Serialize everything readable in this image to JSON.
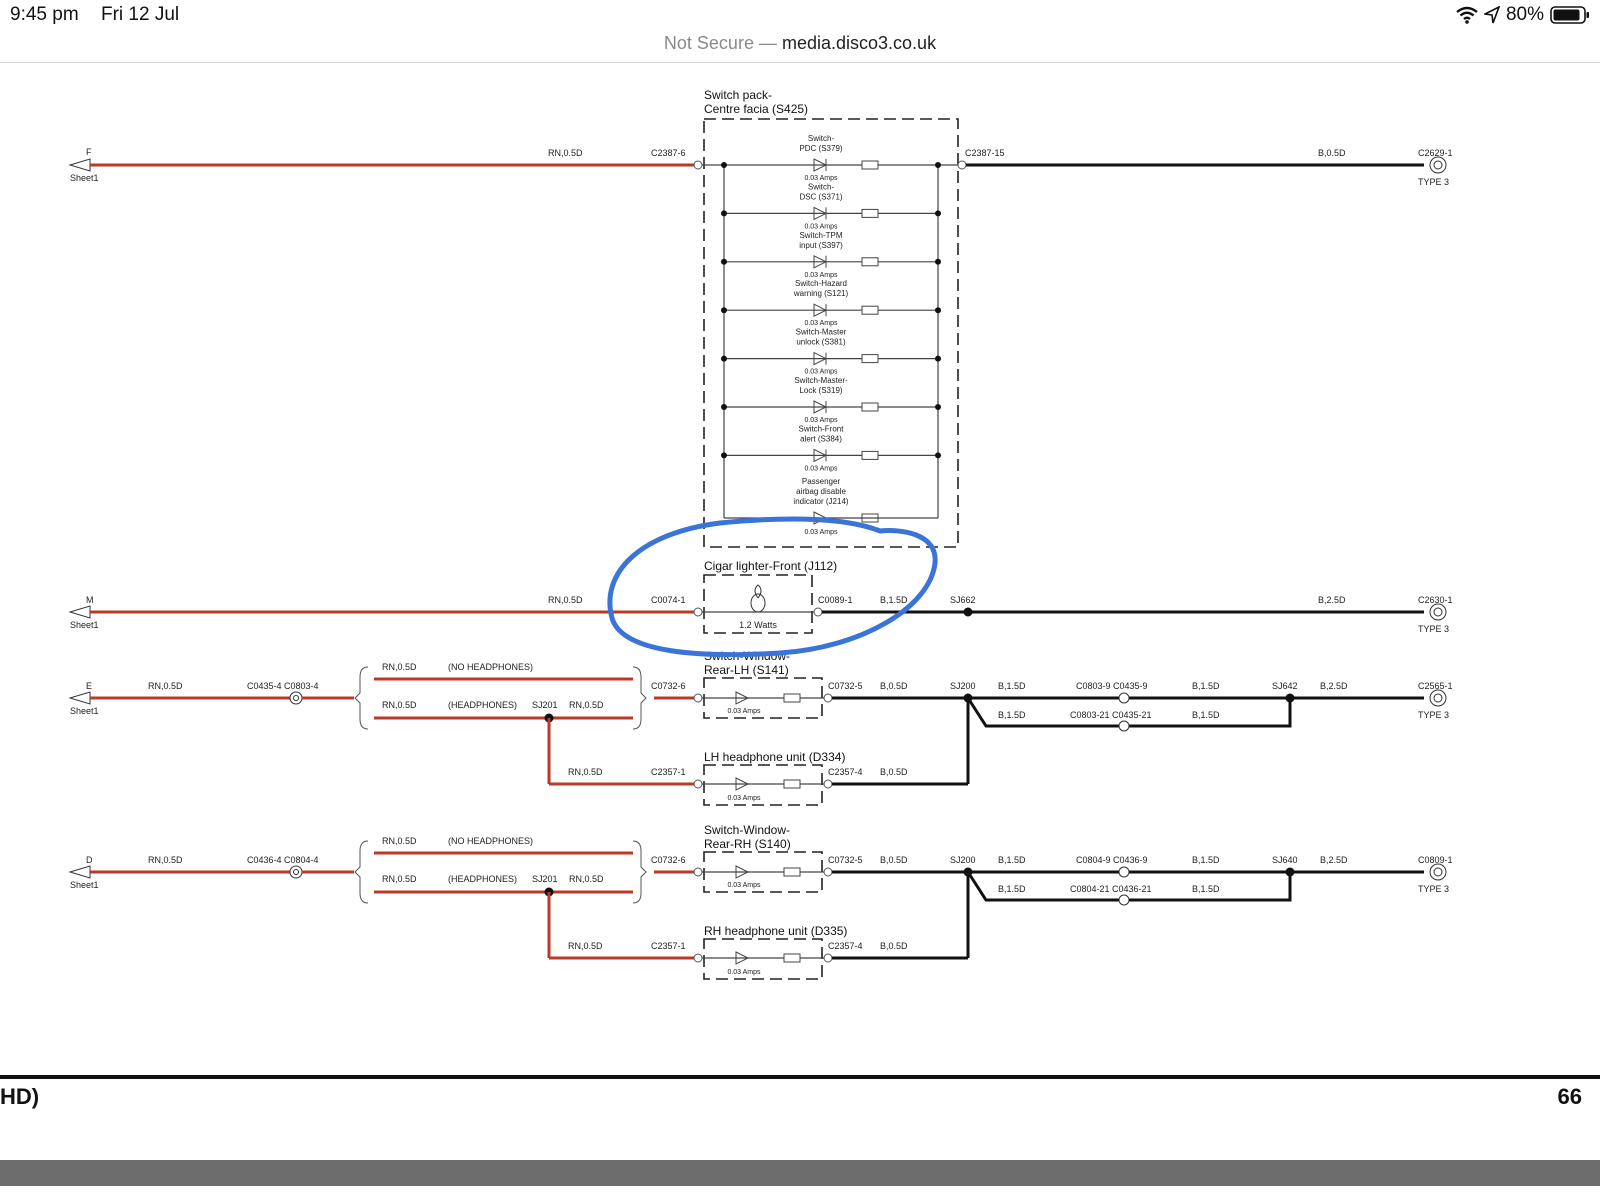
{
  "status_bar": {
    "time": "9:45 pm",
    "date": "Fri 12 Jul",
    "battery": "80%",
    "icons": [
      "wifi-icon",
      "location-icon",
      "battery-icon"
    ]
  },
  "browser": {
    "security": "Not Secure",
    "separator": "—",
    "host": "media.disco3.co.uk"
  },
  "diagram": {
    "switch_pack_title_1": "Switch pack-",
    "switch_pack_title_2": "Centre facia (S425)",
    "switches": [
      {
        "label1": "Switch-",
        "label2": "PDC (S379)",
        "amps": "0.03 Amps"
      },
      {
        "label1": "Switch-",
        "label2": "DSC (S371)",
        "amps": "0.03 Amps"
      },
      {
        "label1": "Switch-TPM",
        "label2": "input (S397)",
        "amps": "0.03 Amps"
      },
      {
        "label1": "Switch-Hazard",
        "label2": "warning (S121)",
        "amps": "0.03 Amps"
      },
      {
        "label1": "Switch-Master",
        "label2": "unlock (S381)",
        "amps": "0.03 Amps"
      },
      {
        "label1": "Switch-Master-",
        "label2": "Lock (S319)",
        "amps": "0.03 Amps"
      },
      {
        "label1": "Switch-Front",
        "label2": "alert (S384)",
        "amps": "0.03 Amps"
      }
    ],
    "airbag": {
      "label1": "Passenger",
      "label2": "airbag disable",
      "label3": "indicator (J214)",
      "amps": "0.03 Amps"
    },
    "row_f": {
      "sheet_letter": "F",
      "sheet": "Sheet1",
      "wire_left": "RN,0.5D",
      "conn_left": "C2387-6",
      "conn_right": "C2387-15",
      "wire_right": "B,0.5D",
      "conn_end": "C2629-1",
      "type": "TYPE 3"
    },
    "cigar": {
      "title": "Cigar lighter-Front (J112)",
      "watts": "1.2 Watts"
    },
    "row_m": {
      "sheet_letter": "M",
      "sheet": "Sheet1",
      "wire_left": "RN,0.5D",
      "conn_left": "C0074-1",
      "conn_right": "C0089-1",
      "wire_mid": "B,1.5D",
      "splice": "SJ662",
      "wire_right": "B,2.5D",
      "conn_end": "C2630-1",
      "type": "TYPE 3"
    },
    "row_e": {
      "sheet_letter": "E",
      "sheet": "Sheet1",
      "wire_left": "RN,0.5D",
      "conn_left": "C0435-4 C0803-4",
      "wire_nohp": "RN,0.5D",
      "note_nohp": "(NO HEADPHONES)",
      "wire_hp": "RN,0.5D",
      "note_hp": "(HEADPHONES)",
      "splice_hp": "SJ201",
      "wire_hp2": "RN,0.5D",
      "switch_title1": "Switch-Window-",
      "switch_title2": "Rear-LH (S141)",
      "conn_sw_in": "C0732-6",
      "conn_sw_out": "C0732-5",
      "wire_sw_out": "B,0.5D",
      "amps": "0.03 Amps",
      "splice_main": "SJ200",
      "wire_main1": "B,1.5D",
      "conn_main1": "C0803-9 C0435-9",
      "wire_main2": "B,1.5D",
      "splice_end": "SJ642",
      "wire_end": "B,2.5D",
      "conn_end": "C2565-1",
      "type": "TYPE 3",
      "wire_lower1": "B,1.5D",
      "conn_lower": "C0803-21 C0435-21",
      "wire_lower2": "B,1.5D",
      "hp_wire": "RN,0.5D",
      "hp_conn_in": "C2357-1",
      "hp_title": "LH headphone unit (D334)",
      "hp_conn_out": "C2357-4",
      "hp_wire_out": "B,0.5D",
      "hp_amps": "0.03 Amps"
    },
    "row_d": {
      "sheet_letter": "D",
      "sheet": "Sheet1",
      "wire_left": "RN,0.5D",
      "conn_left": "C0436-4 C0804-4",
      "wire_nohp": "RN,0.5D",
      "note_nohp": "(NO HEADPHONES)",
      "wire_hp": "RN,0.5D",
      "note_hp": "(HEADPHONES)",
      "splice_hp": "SJ201",
      "wire_hp2": "RN,0.5D",
      "switch_title1": "Switch-Window-",
      "switch_title2": "Rear-RH (S140)",
      "conn_sw_in": "C0732-6",
      "conn_sw_out": "C0732-5",
      "wire_sw_out": "B,0.5D",
      "amps": "0.03 Amps",
      "splice_main": "SJ200",
      "wire_main1": "B,1.5D",
      "conn_main1": "C0804-9 C0436-9",
      "wire_main2": "B,1.5D",
      "splice_end": "SJ640",
      "wire_end": "B,2.5D",
      "conn_end": "C0809-1",
      "type": "TYPE 3",
      "wire_lower1": "B,1.5D",
      "conn_lower": "C0804-21 C0436-21",
      "wire_lower2": "B,1.5D",
      "hp_wire": "RN,0.5D",
      "hp_conn_in": "C2357-1",
      "hp_title": "RH headphone unit (D335)",
      "hp_conn_out": "C2357-4",
      "hp_wire_out": "B,0.5D",
      "hp_amps": "0.03 Amps"
    }
  },
  "footer": {
    "left": "HD)",
    "page": "66"
  },
  "colors": {
    "red_wire": "#b83a28",
    "black_wire": "#111111",
    "annotation": "#3a74d8"
  }
}
